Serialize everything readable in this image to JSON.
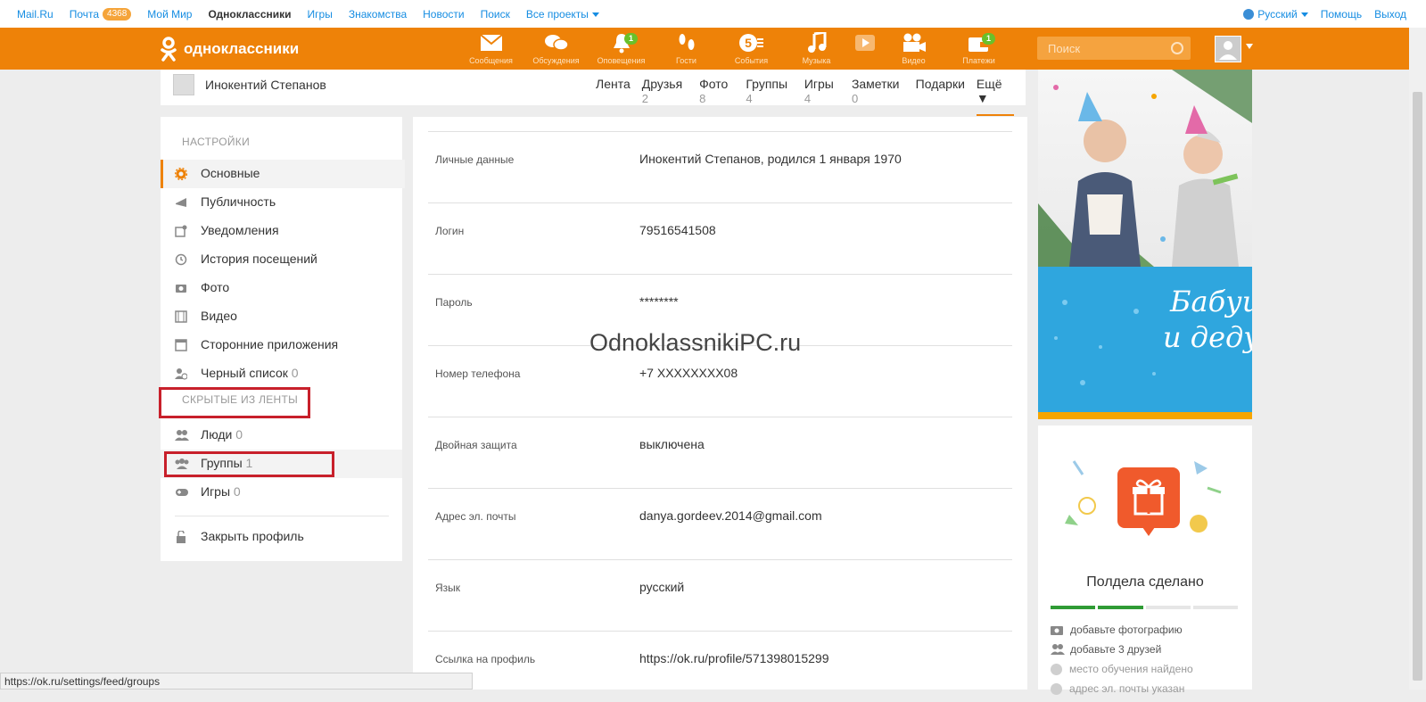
{
  "mailbar": {
    "left": [
      "Mail.Ru",
      "Почта",
      "Мой Мир",
      "Одноклассники",
      "Игры",
      "Знакомства",
      "Новости",
      "Поиск",
      "Все проекты"
    ],
    "mail_count": "4368",
    "right": [
      "Русский",
      "Помощь",
      "Выход"
    ]
  },
  "header": {
    "logo_text": "одноклассники",
    "nav": [
      {
        "label": "Сообщения",
        "icon": "envelope-icon",
        "count": ""
      },
      {
        "label": "Обсуждения",
        "icon": "chat-icon",
        "count": ""
      },
      {
        "label": "Оповещения",
        "icon": "bell-icon",
        "count": "1"
      },
      {
        "label": "Гости",
        "icon": "footprints-icon",
        "count": ""
      },
      {
        "label": "События",
        "icon": "events-icon",
        "count": ""
      },
      {
        "label": "Музыка",
        "icon": "music-icon",
        "count": ""
      },
      {
        "label": "",
        "icon": "play-icon",
        "count": ""
      },
      {
        "label": "Видео",
        "icon": "video-camera-icon",
        "count": ""
      },
      {
        "label": "Платежи",
        "icon": "wallet-icon",
        "count": "1"
      }
    ],
    "search_placeholder": "Поиск",
    "colors": {
      "header": "#ee8208",
      "count_badge": "#6ac02a"
    }
  },
  "profile": {
    "name": "Инокентий Степанов",
    "tabs": [
      {
        "label": "Лента",
        "count": ""
      },
      {
        "label": "Друзья",
        "count": "2"
      },
      {
        "label": "Фото",
        "count": "8"
      },
      {
        "label": "Группы",
        "count": "4"
      },
      {
        "label": "Игры",
        "count": "4"
      },
      {
        "label": "Заметки",
        "count": "0"
      },
      {
        "label": "Подарки",
        "count": ""
      },
      {
        "label": "Ещё ▼",
        "count": ""
      }
    ]
  },
  "settings": {
    "section_title": "НАСТРОЙКИ",
    "items": [
      {
        "label": "Основные",
        "count": "",
        "icon": "gear-icon"
      },
      {
        "label": "Публичность",
        "count": "",
        "icon": "megaphone-icon"
      },
      {
        "label": "Уведомления",
        "count": "",
        "icon": "notification-icon"
      },
      {
        "label": "История посещений",
        "count": "",
        "icon": "history-icon"
      },
      {
        "label": "Фото",
        "count": "",
        "icon": "camera-icon"
      },
      {
        "label": "Видео",
        "count": "",
        "icon": "film-icon"
      },
      {
        "label": "Сторонние приложения",
        "count": "",
        "icon": "apps-icon"
      },
      {
        "label": "Черный список",
        "count": "0",
        "icon": "blocked-user-icon"
      }
    ],
    "hidden_title": "СКРЫТЫЕ ИЗ ЛЕНТЫ",
    "hidden_items": [
      {
        "label": "Люди",
        "count": "0",
        "icon": "people-icon"
      },
      {
        "label": "Группы",
        "count": "1",
        "icon": "groups-icon"
      },
      {
        "label": "Игры",
        "count": "0",
        "icon": "gamepad-icon"
      }
    ],
    "close_profile": "Закрыть профиль"
  },
  "personal": {
    "rows": [
      {
        "key": "Личные данные",
        "value": "Инокентий Степанов, родился 1 января 1970"
      },
      {
        "key": "Логин",
        "value": "79516541508"
      },
      {
        "key": "Пароль",
        "value": "********"
      },
      {
        "key": "Номер телефона",
        "value": "+7 XXXXXXXX08"
      },
      {
        "key": "Двойная защита",
        "value": "выключена"
      },
      {
        "key": "Адрес эл. почты",
        "value": "danya.gordeev.2014@gmail.com"
      },
      {
        "key": "Язык",
        "value": "русский"
      },
      {
        "key": "Ссылка на профиль",
        "value": "https://ok.ru/profile/571398015299"
      }
    ]
  },
  "watermark": "OdnoklassnikiPC.ru",
  "banner": {
    "text_line1": "Бабуш",
    "text_line2": "и дедуш"
  },
  "promo": {
    "title": "Полдела сделано",
    "progress_done": 2,
    "progress_total": 4,
    "tasks": [
      {
        "label": "добавьте фотографию",
        "done": false,
        "icon": "camera-icon"
      },
      {
        "label": "добавьте 3 друзей",
        "done": false,
        "icon": "people-icon"
      },
      {
        "label": "место обучения найдено",
        "done": true,
        "icon": "check-icon"
      },
      {
        "label": "адрес эл. почты указан",
        "done": true,
        "icon": "check-icon"
      }
    ]
  },
  "status_url": "https://ok.ru/settings/feed/groups"
}
